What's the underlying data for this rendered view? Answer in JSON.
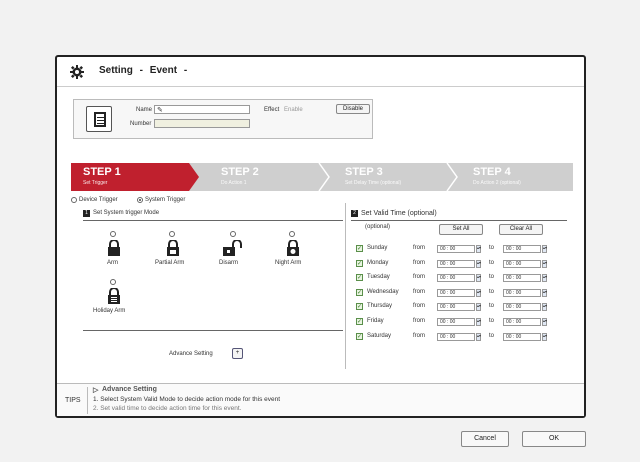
{
  "header": {
    "title": "Setting",
    "sep1": "-",
    "event": "Event",
    "sep2": "-"
  },
  "info": {
    "name_label": "Name",
    "number_label": "Number",
    "effect_label": "Effect",
    "enable_label": "Enable",
    "disable_label": "Disable"
  },
  "steps": [
    {
      "title": "STEP 1",
      "sub": "Set Trigger"
    },
    {
      "title": "STEP 2",
      "sub": "Do Action 1"
    },
    {
      "title": "STEP 3",
      "sub": "Set Delay Time (optional)"
    },
    {
      "title": "STEP 4",
      "sub": "Do Action 2 (optional)"
    }
  ],
  "trigger": {
    "device_trigger": "Device Trigger",
    "system_trigger": "System Trigger",
    "mode_badge": "1",
    "mode_label": "Set System trigger Mode",
    "modes": [
      "Arm",
      "Partial Arm",
      "Disarm",
      "Night Arm",
      "Holiday Arm"
    ],
    "advance_label": "Advance Setting"
  },
  "valid_time": {
    "badge": "2",
    "title": "Set Valid Time (optional)",
    "optional": "(optional)",
    "set_all": "Set All",
    "clear_all": "Clear All",
    "days": [
      {
        "day": "Sunday",
        "from_label": "from",
        "from": "00 : 00",
        "to_label": "to",
        "to": "00 : 00"
      },
      {
        "day": "Monday",
        "from_label": "from",
        "from": "00 : 00",
        "to_label": "to",
        "to": "00 : 00"
      },
      {
        "day": "Tuesday",
        "from_label": "from",
        "from": "00 : 00",
        "to_label": "to",
        "to": "00 : 00"
      },
      {
        "day": "Wednesday",
        "from_label": "from",
        "from": "00 : 00",
        "to_label": "to",
        "to": "00 : 00"
      },
      {
        "day": "Thursday",
        "from_label": "from",
        "from": "00 : 00",
        "to_label": "to",
        "to": "00 : 00"
      },
      {
        "day": "Friday",
        "from_label": "from",
        "from": "00 : 00",
        "to_label": "to",
        "to": "00 : 00"
      },
      {
        "day": "Saturday",
        "from_label": "from",
        "from": "00 : 00",
        "to_label": "to",
        "to": "00 : 00"
      }
    ]
  },
  "tips": {
    "label": "TIPS",
    "heading": "Advance Setting",
    "line1": "1. Select System Valid Mode to decide action mode for this event",
    "line2": "2. Set valid time to decide action time for this event."
  },
  "footer": {
    "cancel": "Cancel",
    "ok": "OK"
  },
  "colors": {
    "accent": "#c0202e",
    "step_inactive": "#cfcfcf"
  }
}
